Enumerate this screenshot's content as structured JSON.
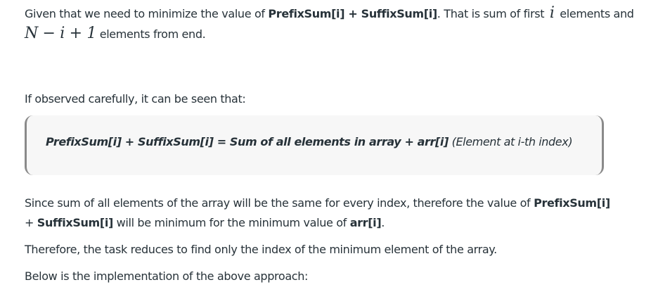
{
  "p1": {
    "before": "Given that we need to minimize the value of ",
    "bold": "PrefixSum[i] + SuffixSum[i]",
    "mid": ". That is sum of first ",
    "math_i": "i",
    "after": " elements and",
    "math_expr": "N − i + 1",
    "end": " elements from end."
  },
  "p2": {
    "text": "If observed carefully, it can be seen that:"
  },
  "quote": {
    "bold": "PrefixSum[i] + SuffixSum[i] = Sum of all elements in array + arr[i]",
    "normal": " (Element at i-th index)"
  },
  "p3": {
    "line1_before": "Since sum of all elements of the array will be the same for every index, therefore the value of ",
    "line1_bold": "PrefixSum[i]",
    "line2_plus": "+ ",
    "line2_bold": "SuffixSum[i]",
    "line2_mid": " will be minimum for the minimum value of ",
    "line2_bold2": "arr[i]",
    "line2_end": "."
  },
  "p4": {
    "text": "Therefore, the task reduces to find only the index of the minimum element of the array."
  },
  "p5": {
    "text": "Below is the implementation of the above approach:"
  }
}
